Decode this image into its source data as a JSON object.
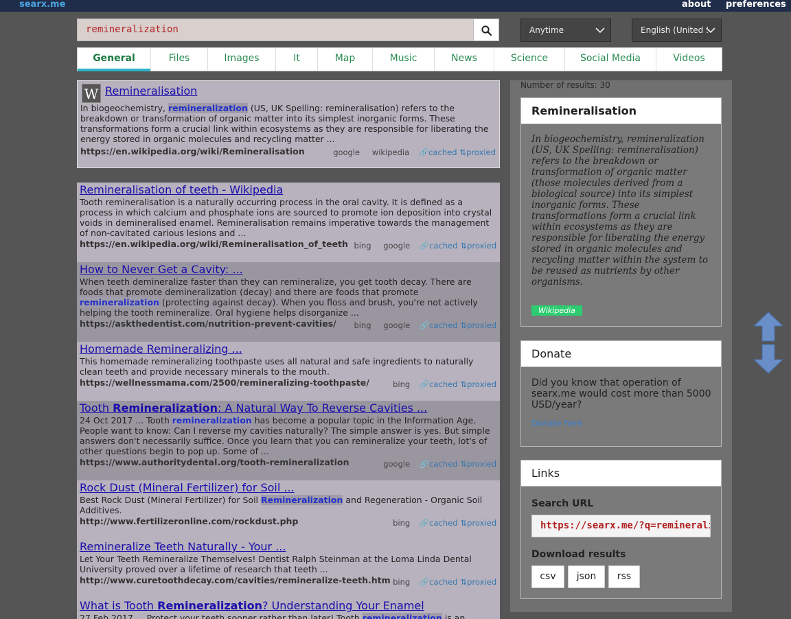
{
  "header": {
    "brand": "searx.me",
    "about": "about",
    "preferences": "preferences"
  },
  "search": {
    "query": "remineralization"
  },
  "filters": {
    "time": "Anytime",
    "language": "English (United States)"
  },
  "tabs": [
    "General",
    "Files",
    "Images",
    "It",
    "Map",
    "Music",
    "News",
    "Science",
    "Social Media",
    "Videos"
  ],
  "results": [
    {
      "title": "Remineralisation",
      "content_pre": "In biogeochemistry, ",
      "content_hl": "remineralization",
      "content_post": " (US, UK Spelling: remineralisation) refers to the breakdown or transformation of organic matter into its simplest inorganic forms. These transformations form a crucial link within ecosystems as they are responsible for liberating the energy stored in organic molecules and recycling matter ...",
      "url": "https://en.wikipedia.org/wiki/Remineralisation",
      "engines": [
        "google",
        "wikipedia"
      ]
    },
    {
      "title": "Remineralisation of teeth - Wikipedia",
      "content": "Tooth remineralisation is a naturally occurring process in the oral cavity. It is defined as a process in which calcium and phosphate ions are sourced to promote ion deposition into crystal voids in demineralised enamel. Remineralisation remains imperative towards the management of non-cavitated carious lesions and ...",
      "url": "https://en.wikipedia.org/wiki/Remineralisation_of_teeth",
      "engines": [
        "bing",
        "google"
      ]
    },
    {
      "title": "How to Never Get a Cavity: ...",
      "content_pre": "When teeth demineralize faster than they can remineralize, you get tooth decay. There are foods that promote demineralization (decay) and there are foods that promote ",
      "content_hl": "remineralization",
      "content_post": " (protecting against decay). When you floss and brush, you're not actively helping the tooth remineralize. Oral hygiene helps disorganize ...",
      "url": "https://askthedentist.com/nutrition-prevent-cavities/",
      "engines": [
        "bing",
        "google"
      ]
    },
    {
      "title": "Homemade Remineralizing ...",
      "content": "This homemade remineralizing toothpaste uses all natural and safe ingredients to naturally clean teeth and provide necessary minerals to the mouth.",
      "url": "https://wellnessmama.com/2500/remineralizing-toothpaste/",
      "engines": [
        "bing"
      ]
    },
    {
      "title_pre": "Tooth ",
      "title_hl": "Remineralization",
      "title_post": ": A Natural Way To Reverse Cavities ...",
      "content_pre": "24 Oct 2017 ... Tooth ",
      "content_hl": "remineralization",
      "content_post": " has become a popular topic in the Information Age. People want to know: Can I reverse my cavities naturally? The simple answer is yes. But simple answers don't necessarily suffice. Once you learn that you can remineralize your teeth, lot's of other questions begin to pop up. Some of ...",
      "url": "https://www.authoritydental.org/tooth-remineralization",
      "engines": [
        "google"
      ]
    },
    {
      "title": "Rock Dust (Mineral Fertilizer) for Soil ...",
      "content_pre": "Best Rock Dust (Mineral Fertilizer) for Soil ",
      "content_hl": "Remineralization",
      "content_post": " and Regeneration - Organic Soil Additives.",
      "url": "http://www.fertilizeronline.com/rockdust.php",
      "engines": [
        "bing"
      ]
    },
    {
      "title": "Remineralize Teeth Naturally - Your ...",
      "content": "Let Your Teeth Remineralize Themselves! Dentist Ralph Steinman at the Loma Linda Dental University proved over a lifetime of research that teeth ...",
      "url": "http://www.curetoothdecay.com/cavities/remineralize-teeth.htm",
      "engines": [
        "bing"
      ]
    },
    {
      "title_pre": "What is Tooth ",
      "title_hl": "Remineralization",
      "title_post": "? Understanding Your Enamel",
      "content_pre": "27 Feb 2017 ... Protect your teeth sooner rather than later! Tooth ",
      "content_hl": "remineralization",
      "content_post": " is an organic"
    }
  ],
  "result_links": {
    "cached": "cached",
    "proxied": "proxied"
  },
  "sidebar": {
    "num_results_label": "Number of results: 30",
    "infobox": {
      "title": "Remineralisation",
      "text": "In biogeochemistry, remineralization (US, UK Spelling: remineralisation) refers to the breakdown or transformation of organic matter (those molecules derived from a biological source) into its simplest inorganic forms. These transformations form a crucial link within ecosystems as they are responsible for liberating the energy stored in organic molecules and recycling matter within the system to be reused as nutrients by other organisms.",
      "source": "Wikipedia"
    },
    "donate": {
      "title": "Donate",
      "text": "Did you know that operation of searx.me would cost more than 5000 USD/year?",
      "link": "Donate here"
    },
    "links": {
      "title": "Links",
      "search_url_label": "Search URL",
      "search_url": "https://searx.me/?q=remineralization",
      "download_label": "Download results",
      "formats": [
        "csv",
        "json",
        "rss"
      ]
    }
  },
  "colors": {
    "topbar": "#1f2d4a",
    "background": "#555555",
    "accent": "#2bb3c9",
    "link": "#1a0dab"
  }
}
